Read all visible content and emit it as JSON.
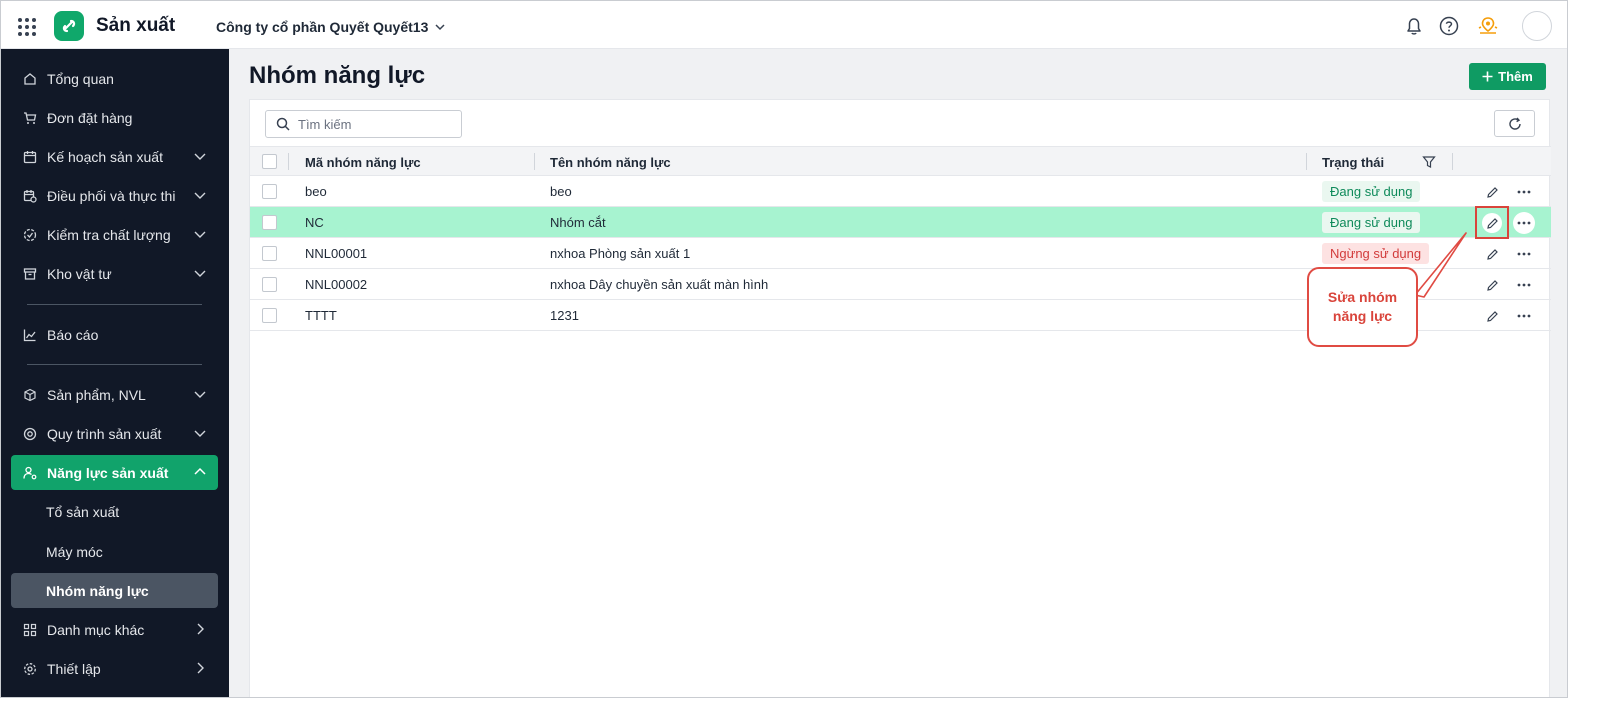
{
  "app": {
    "title": "Sản xuất",
    "company": "Công ty cổ phần Quyết Quyết13"
  },
  "topbar": {
    "icons": [
      "apps-grid-icon",
      "bell-icon",
      "help-icon",
      "location-icon",
      "avatar"
    ]
  },
  "sidebar": {
    "items": [
      {
        "label": "Tổng quan",
        "icon": "home-icon"
      },
      {
        "label": "Đơn đặt hàng",
        "icon": "cart-icon"
      },
      {
        "label": "Kế hoạch sản xuất",
        "icon": "calendar-icon"
      },
      {
        "label": "Điều phối và thực thi",
        "icon": "calendar-clock-icon"
      },
      {
        "label": "Kiểm tra chất lượng",
        "icon": "check-circle-icon"
      },
      {
        "label": "Kho vật tư",
        "icon": "archive-icon"
      },
      {
        "label": "Báo cáo",
        "icon": "chart-icon"
      },
      {
        "label": "Sản phẩm, NVL",
        "icon": "cube-icon"
      },
      {
        "label": "Quy trình sản xuất",
        "icon": "process-icon"
      },
      {
        "label": "Năng lực sản xuất",
        "icon": "user-gear-icon"
      },
      {
        "label": "Tổ sản xuất"
      },
      {
        "label": "Máy móc"
      },
      {
        "label": "Nhóm năng lực"
      },
      {
        "label": "Danh mục khác",
        "icon": "grid-icon"
      },
      {
        "label": "Thiết lập",
        "icon": "settings-icon"
      }
    ]
  },
  "page": {
    "title": "Nhóm năng lực",
    "add_label": "Thêm",
    "search_placeholder": "Tìm kiếm"
  },
  "table": {
    "columns": [
      "Mã nhóm năng lực",
      "Tên nhóm năng lực",
      "Trạng thái"
    ],
    "rows": [
      {
        "code": "beo",
        "name": "beo",
        "status": "Đang sử dụng",
        "active": true
      },
      {
        "code": "NC",
        "name": "Nhóm cắt",
        "status": "Đang sử dụng",
        "active": true
      },
      {
        "code": "NNL00001",
        "name": "nxhoa Phòng sản xuất 1",
        "status": "Ngừng sử dụng",
        "active": false
      },
      {
        "code": "NNL00002",
        "name": "nxhoa Dây chuyền sản xuất màn hình",
        "status": "",
        "active": true
      },
      {
        "code": "TTTT",
        "name": "1231",
        "status": "",
        "active": true
      }
    ]
  },
  "callout": {
    "text": "Sửa nhóm năng lực"
  },
  "colors": {
    "brand": "#10a86b",
    "sidebar_bg": "#111827",
    "highlight_row": "#a7f3d0",
    "callout": "#d9443b"
  }
}
